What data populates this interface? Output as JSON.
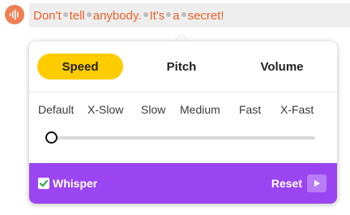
{
  "input": {
    "words": [
      "Don't",
      "tell",
      "anybody.",
      "It's",
      "a",
      "secret!"
    ]
  },
  "tabs": [
    {
      "label": "Speed",
      "active": true
    },
    {
      "label": "Pitch",
      "active": false
    },
    {
      "label": "Volume",
      "active": false
    }
  ],
  "speed_options": [
    "Default",
    "X-Slow",
    "Slow",
    "Medium",
    "Fast",
    "X-Fast"
  ],
  "slider": {
    "selected": "Default"
  },
  "footer": {
    "whisper_label": "Whisper",
    "whisper_checked": true,
    "reset_label": "Reset"
  },
  "colors": {
    "accent_orange": "#e8622c",
    "tab_active": "#ffcc00",
    "footer_bg": "#9b45f2",
    "checkbox_check": "#34a853"
  },
  "icons": {
    "mic": "sound-wave-icon",
    "play": "play-icon",
    "check": "check-icon"
  }
}
